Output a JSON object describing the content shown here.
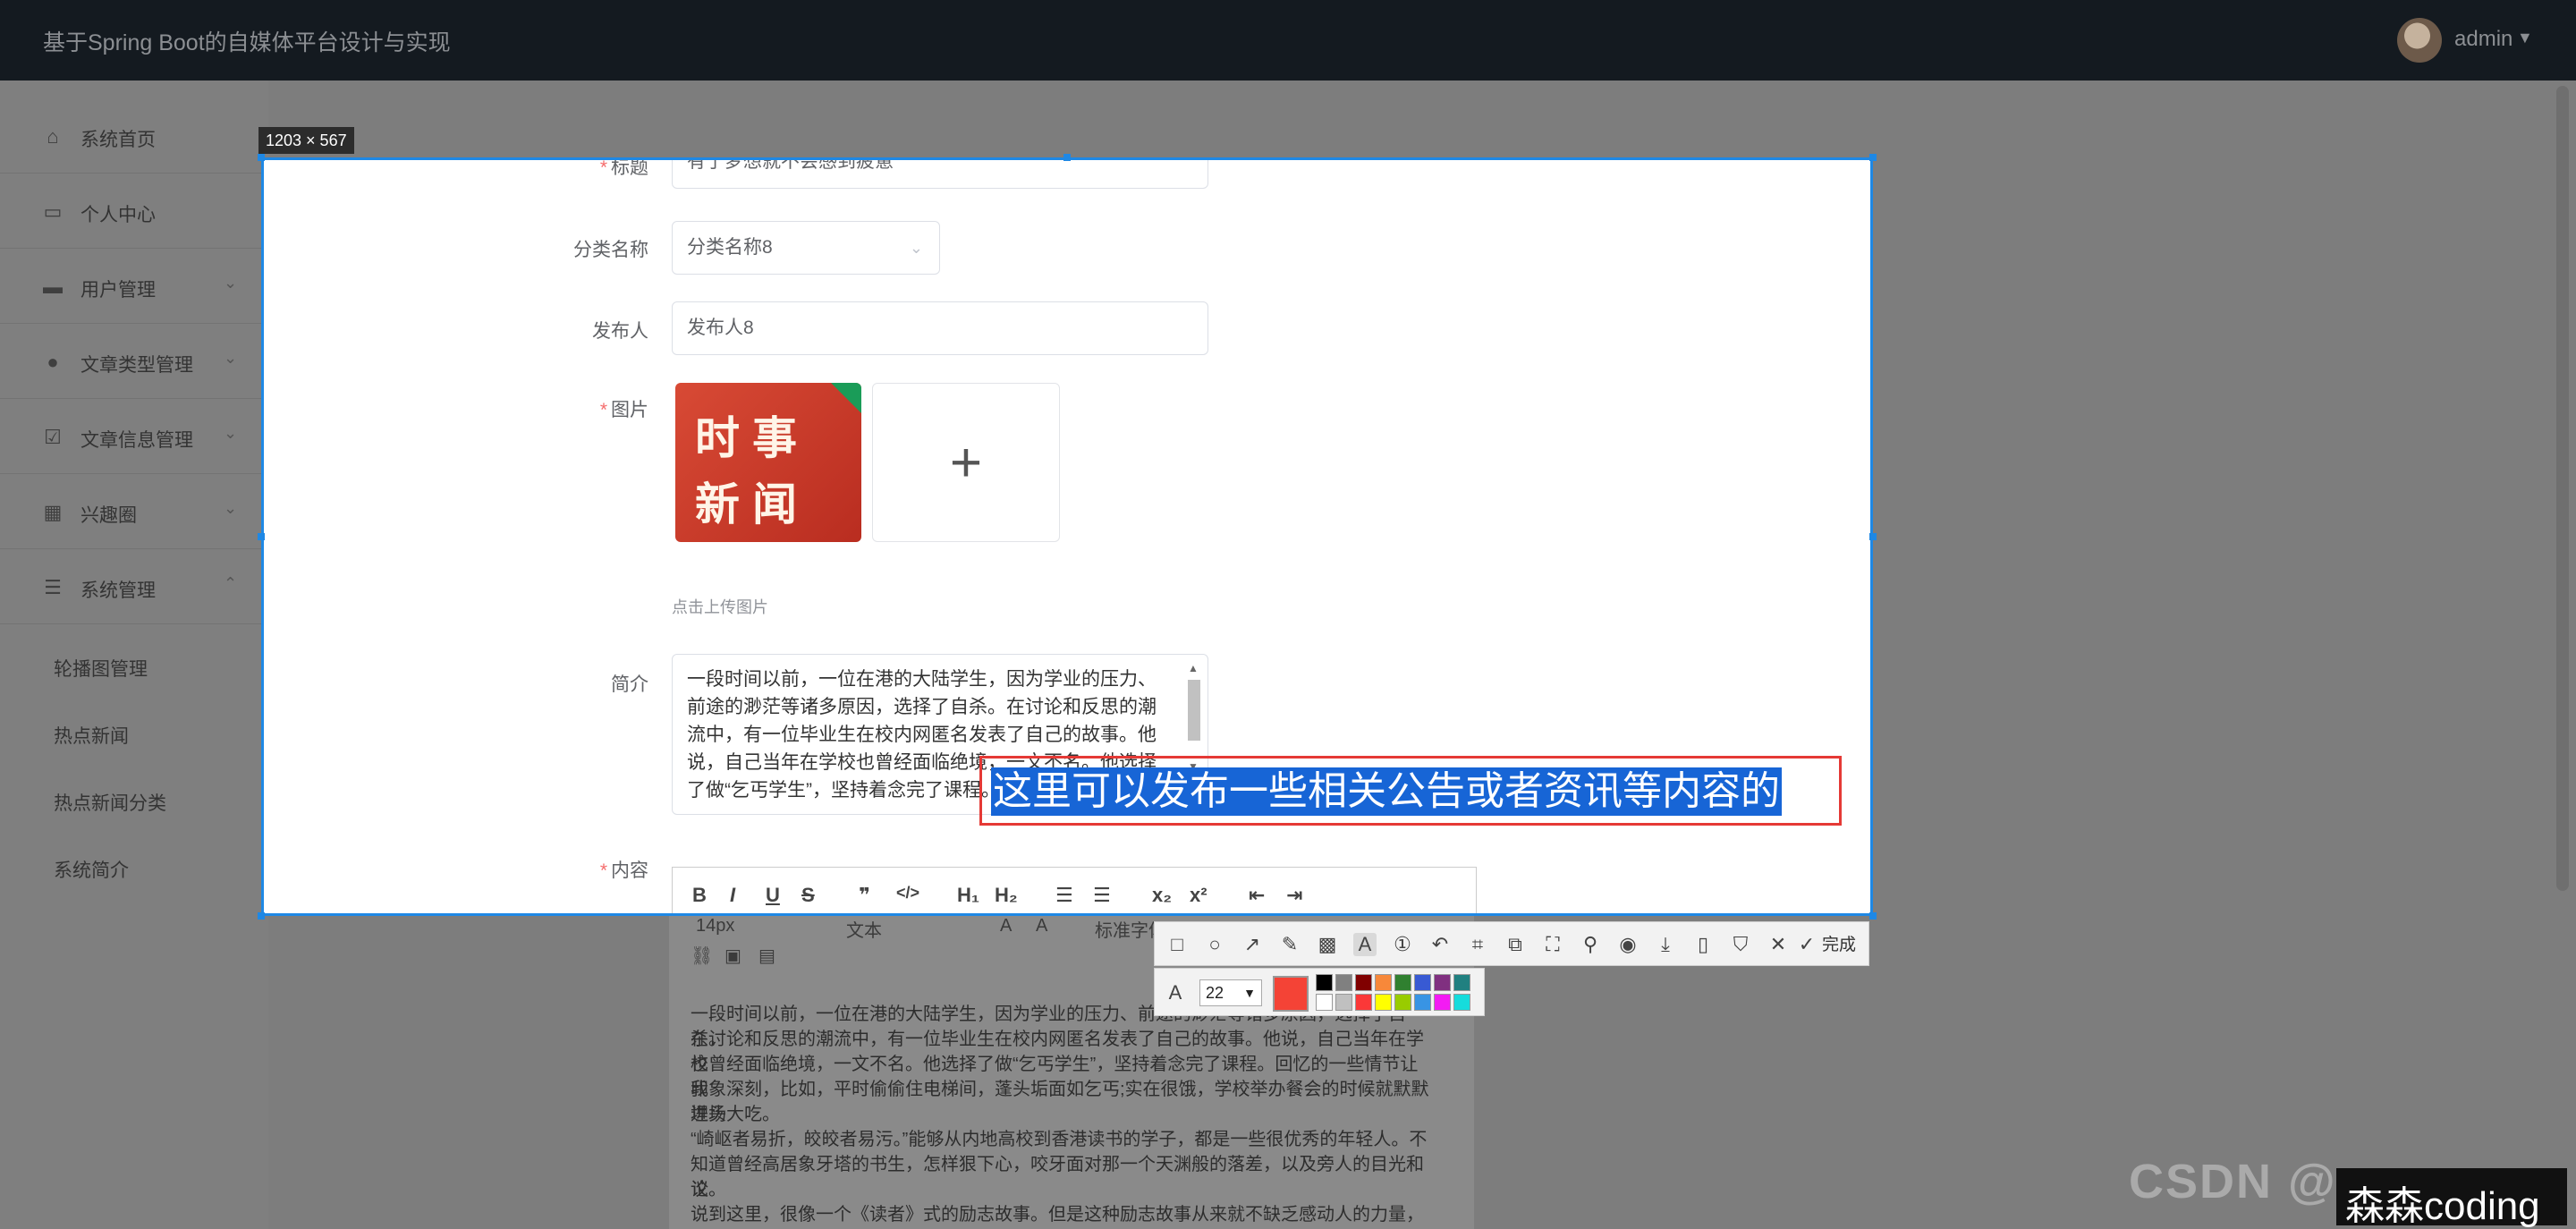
{
  "app": {
    "title": "基于Spring Boot的自媒体平台设计与实现",
    "user": "admin"
  },
  "sidebar": {
    "items": [
      {
        "label": "系统首页",
        "icon": "home-icon"
      },
      {
        "label": "个人中心",
        "icon": "id-card-icon"
      },
      {
        "label": "用户管理",
        "icon": "chat-icon"
      },
      {
        "label": "文章类型管理",
        "icon": "user-icon"
      },
      {
        "label": "文章信息管理",
        "icon": "checkbox-icon"
      },
      {
        "label": "兴趣圈",
        "icon": "grid-icon"
      },
      {
        "label": "系统管理",
        "icon": "sliders-icon"
      }
    ],
    "sub_items": [
      "轮播图管理",
      "热点新闻",
      "热点新闻分类",
      "系统简介"
    ]
  },
  "screenshot": {
    "size_label": "1203 × 567"
  },
  "form": {
    "title_label": "标题",
    "title_value": "有了梦想就不会感到疲惫",
    "category_label": "分类名称",
    "category_value": "分类名称8",
    "publisher_label": "发布人",
    "publisher_value": "发布人8",
    "image_label": "图片",
    "image_text_line1": "时事",
    "image_text_line2": "新闻",
    "upload_hint": "点击上传图片",
    "intro_label": "简介",
    "intro_value": "一段时间以前，一位在港的大陆学生，因为学业的压力、前途的渺茫等诸多原因，选择了自杀。在讨论和反思的潮流中，有一位毕业生在校内网匿名发表了自己的故事。他说，自己当年在学校也曾经面临绝境，一文不名。他选择了做“乞丐学生”，坚持着念完了课程。回忆的一些情节",
    "content_label": "内容"
  },
  "annotation": {
    "text": "这里可以发布一些相关公告或者资讯等内容的"
  },
  "editor": {
    "font_size": "14px",
    "font_type": "文本",
    "font_family": "标准字体",
    "paragraphs": [
      "一段时间以前，一位在港的大陆学生，因为学业的压力、前途的渺茫等诸多原因，选择了自杀。",
      "在讨论和反思的潮流中，有一位毕业生在校内网匿名发表了自己的故事。他说，自己当年在学校",
      "也曾经面临绝境，一文不名。他选择了做“乞丐学生”，坚持着念完了课程。回忆的一些情节让我",
      "印象深刻，比如，平时偷偷住电梯间，蓬头垢面如乞丐;实在很饿，学校举办餐会的时候就默默进场",
      "埋头大吃。",
      "“崎岖者易折，皎皎者易污。”能够从内地高校到香港读书的学子，都是一些很优秀的年轻人。不",
      "知道曾经高居象牙塔的书生，怎样狠下心，咬牙面对那一个天渊般的落差，以及旁人的目光和议",
      "论。",
      "说到这里，很像一个《读者》式的励志故事。但是这种励志故事从来就不缺乏感动人的力量，因"
    ]
  },
  "toolbar": {
    "done_label": "完成",
    "font_size_value": "22",
    "current_color": "#f44336",
    "palette": [
      "#000000",
      "#808080",
      "#800000",
      "#f7883a",
      "#308030",
      "#385ad3",
      "#803080",
      "#208080",
      "#ffffff",
      "#c0c0c0",
      "#fb3838",
      "#ffff00",
      "#99cc00",
      "#3894e4",
      "#f31bf3",
      "#16dcdc"
    ]
  },
  "watermark": {
    "blur_text": "CSDN @ne",
    "text": "森森coding"
  }
}
